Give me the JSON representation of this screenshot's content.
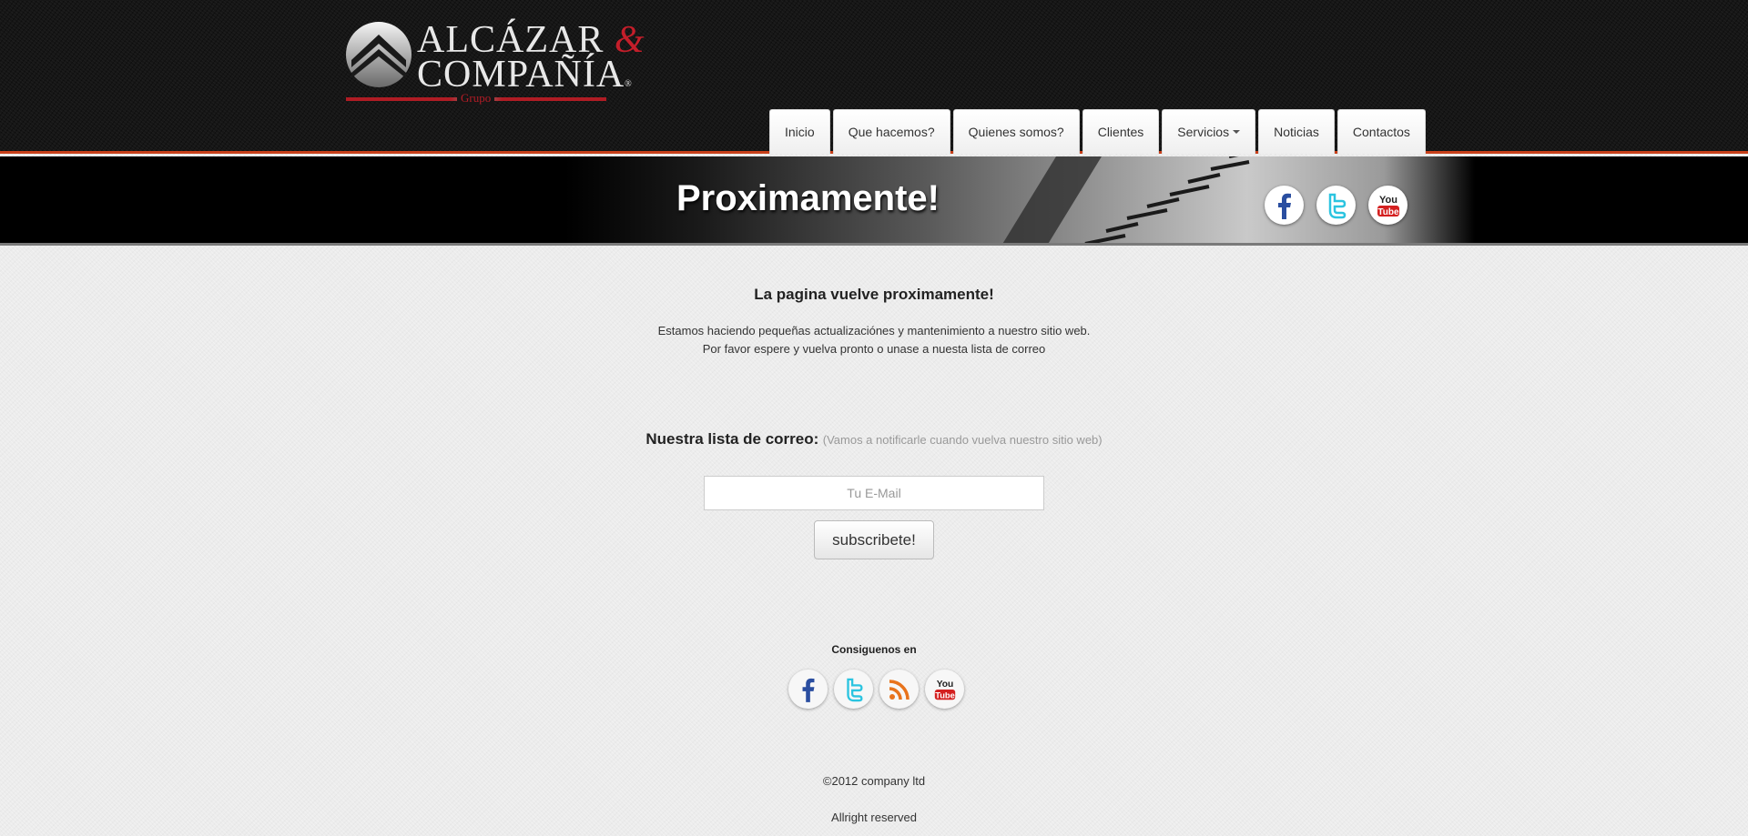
{
  "brand": {
    "line1": "ALCÁZAR",
    "ampersand": "&",
    "line2": "COMPAÑÍA",
    "registered": "®",
    "grupo": "Grupo",
    "accent_color": "#c41e2a",
    "header_border_color": "#c8401a"
  },
  "nav": {
    "items": [
      {
        "label": "Inicio"
      },
      {
        "label": "Que hacemos?"
      },
      {
        "label": "Quienes somos?"
      },
      {
        "label": "Clientes"
      },
      {
        "label": "Servicios",
        "has_dropdown": true
      },
      {
        "label": "Noticias"
      },
      {
        "label": "Contactos"
      }
    ]
  },
  "banner": {
    "title": "Proximamente!",
    "social_icons": [
      "facebook-icon",
      "twitter-icon",
      "youtube-icon"
    ]
  },
  "main": {
    "headline": "La pagina vuelve proximamente!",
    "message_line1": "Estamos haciendo pequeñas actualizaciónes y mantenimiento a nuestro sitio web.",
    "message_line2": "Por favor espere y vuelva pronto o unase a nuesta lista de correo"
  },
  "mailing": {
    "label": "Nuestra lista de correo:",
    "hint": "(Vamos a notificarle cuando vuelva nuestro sitio web)",
    "email_placeholder": "Tu E-Mail",
    "email_value": "",
    "subscribe_label": "subscribete!"
  },
  "follow": {
    "label": "Consiguenos en",
    "icons": [
      "facebook-icon",
      "twitter-icon",
      "rss-icon",
      "youtube-icon"
    ],
    "youtube_text_top": "You",
    "youtube_text_bottom": "Tube"
  },
  "footer": {
    "copyright": "©2012 company ltd",
    "rights": "Allright reserved"
  }
}
